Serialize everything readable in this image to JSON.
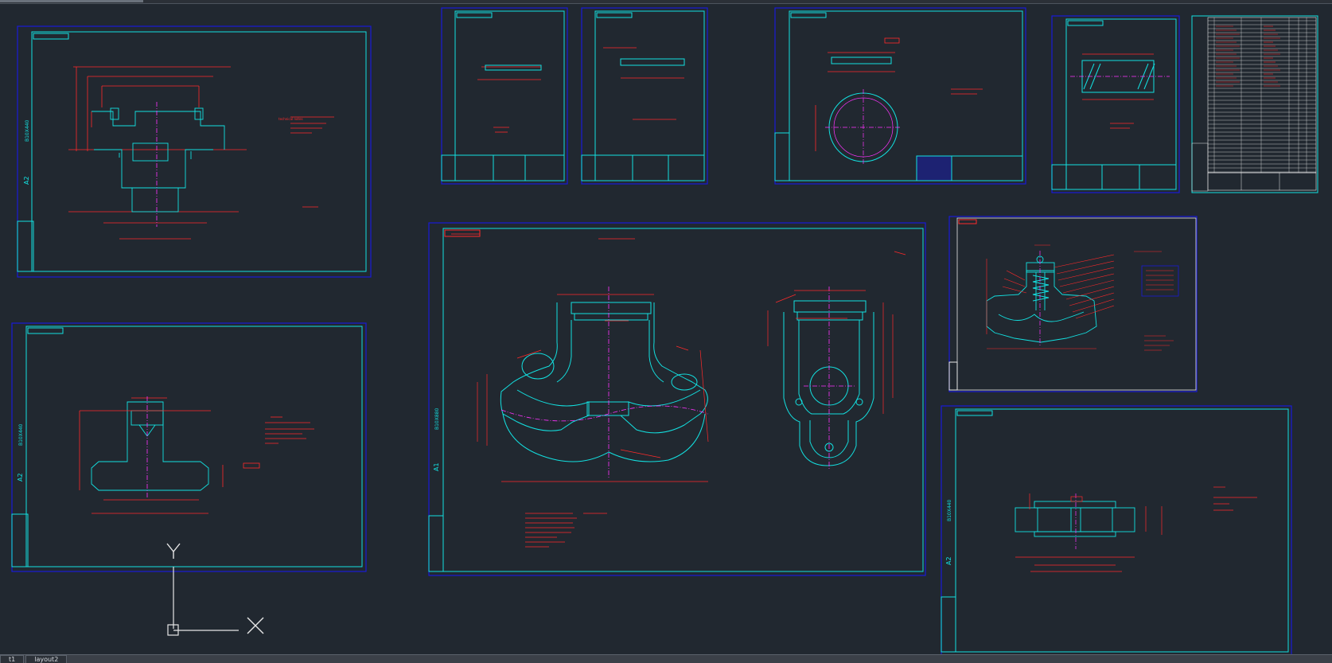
{
  "layout_tabs": [
    {
      "label": "t1"
    },
    {
      "label": "layout2"
    }
  ],
  "ucs": {
    "x_label": "X",
    "y_label": "Y"
  },
  "colors": {
    "background": "#212830",
    "border_blue": "#1a1ad8",
    "frame_cyan": "#13e0e0",
    "annotation_red": "#ff2a2a",
    "center_magenta": "#ff33ff",
    "title_white": "#e8e8e8"
  },
  "sheets": [
    {
      "id": "sheet-top-left",
      "side_label": "A2",
      "side_code": "B10X440"
    },
    {
      "id": "sheet-bottom-left",
      "side_label": "A2",
      "side_code": "B10X440"
    },
    {
      "id": "sheet-small-1"
    },
    {
      "id": "sheet-small-2"
    },
    {
      "id": "sheet-medium-top"
    },
    {
      "id": "sheet-small-3"
    },
    {
      "id": "sheet-parts-list"
    },
    {
      "id": "sheet-main-assembly",
      "side_label": "A1",
      "side_code": "B10X880"
    },
    {
      "id": "sheet-valve-assembly"
    },
    {
      "id": "sheet-bottom-right",
      "side_label": "A2",
      "side_code": "B10X440"
    }
  ]
}
